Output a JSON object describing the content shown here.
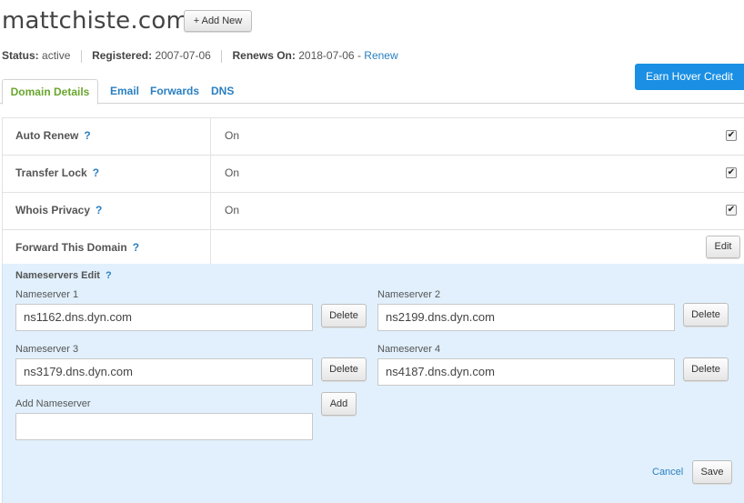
{
  "header": {
    "domain": "mattchiste.com",
    "add_new_label": "+ Add New"
  },
  "status": {
    "status_label": "Status:",
    "status_value": "active",
    "registered_label": "Registered:",
    "registered_value": "2007-07-06",
    "renews_label": "Renews On:",
    "renews_value": "2018-07-06",
    "renews_sep": "-",
    "renew_link": "Renew"
  },
  "earn_credit_label": "Earn Hover Credit",
  "tabs": [
    {
      "label": "Domain Details",
      "active": true
    },
    {
      "label": "Email"
    },
    {
      "label": "Forwards"
    },
    {
      "label": "DNS"
    }
  ],
  "settings": [
    {
      "label": "Auto Renew",
      "help": "?",
      "value": "On",
      "checked": true
    },
    {
      "label": "Transfer Lock",
      "help": "?",
      "value": "On",
      "checked": true
    },
    {
      "label": "Whois Privacy",
      "help": "?",
      "value": "On",
      "checked": true
    },
    {
      "label": "Forward This Domain",
      "help": "?",
      "value": "",
      "edit_label": "Edit"
    }
  ],
  "nameservers": {
    "title": "Nameservers Edit",
    "help": "?",
    "items": [
      {
        "label": "Nameserver 1",
        "value": "ns1162.dns.dyn.com",
        "delete_label": "Delete"
      },
      {
        "label": "Nameserver 2",
        "value": "ns2199.dns.dyn.com",
        "delete_label": "Delete"
      },
      {
        "label": "Nameserver 3",
        "value": "ns3179.dns.dyn.com",
        "delete_label": "Delete"
      },
      {
        "label": "Nameserver 4",
        "value": "ns4187.dns.dyn.com",
        "delete_label": "Delete"
      }
    ],
    "add_label": "Add Nameserver",
    "add_value": "",
    "add_button": "Add",
    "cancel_label": "Cancel",
    "save_label": "Save"
  },
  "colors": {
    "link": "#2a7fc1",
    "active_tab": "#6aa62d",
    "earn_credit_bg": "#1a8fe3",
    "ns_panel_bg": "#e1f0fc"
  }
}
